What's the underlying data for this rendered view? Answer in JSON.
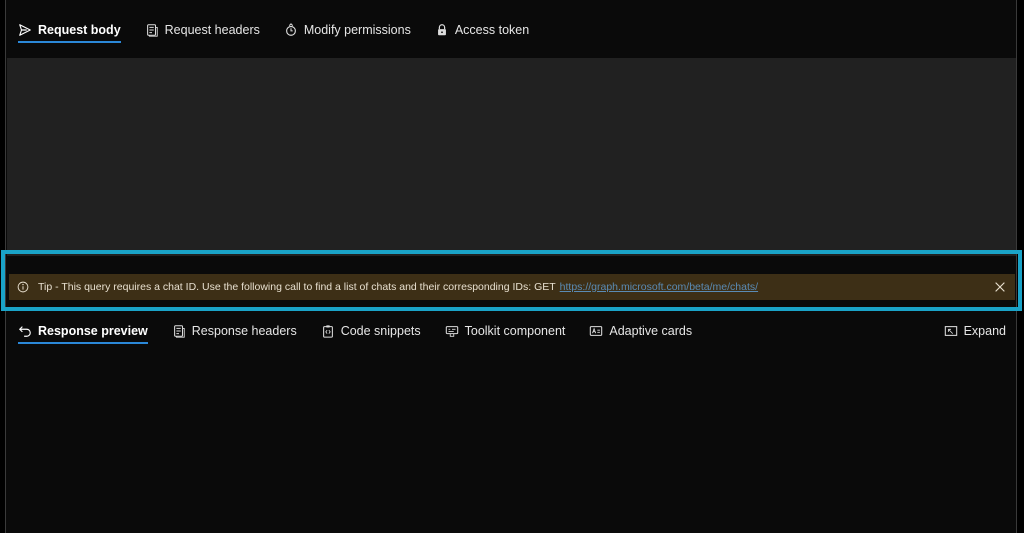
{
  "request_tabs": [
    {
      "label": "Request body",
      "icon": "send-icon",
      "active": true
    },
    {
      "label": "Request headers",
      "icon": "headers-icon",
      "active": false
    },
    {
      "label": "Modify permissions",
      "icon": "permissions-icon",
      "active": false
    },
    {
      "label": "Access token",
      "icon": "lock-icon",
      "active": false
    }
  ],
  "tip": {
    "text": "Tip - This query requires a chat ID. Use the following call to find a list of chats and their corresponding IDs: GET",
    "link": "https://graph.microsoft.com/beta/me/chats/"
  },
  "response_tabs": [
    {
      "label": "Response preview",
      "icon": "undo-arrow-icon",
      "active": true
    },
    {
      "label": "Response headers",
      "icon": "headers-icon",
      "active": false
    },
    {
      "label": "Code snippets",
      "icon": "clipboard-code-icon",
      "active": false
    },
    {
      "label": "Toolkit component",
      "icon": "toolkit-icon",
      "active": false
    },
    {
      "label": "Adaptive cards",
      "icon": "card-icon",
      "active": false
    }
  ],
  "expand_label": "Expand",
  "colors": {
    "accent": "#2b88d8",
    "tip_background": "#3d2f16",
    "highlight": "#1aa3c8",
    "editor_background": "#212121"
  }
}
